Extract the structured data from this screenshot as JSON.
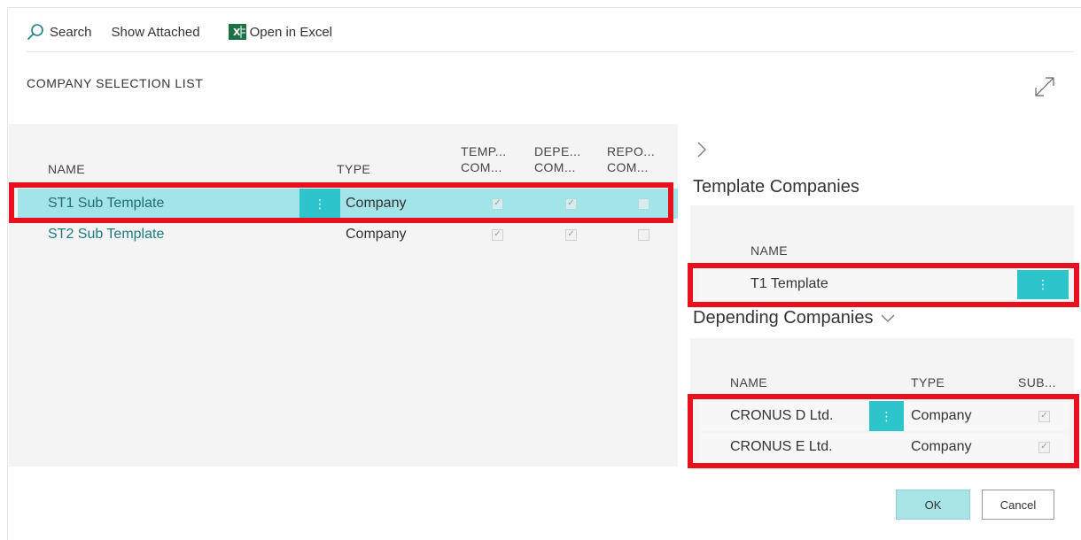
{
  "actionbar": {
    "search_label": "Search",
    "show_attached_label": "Show Attached",
    "open_excel_label": "Open in Excel"
  },
  "page": {
    "title": "COMPANY SELECTION LIST"
  },
  "list": {
    "columns": {
      "name": "NAME",
      "type": "TYPE",
      "template_l1": "TEMP...",
      "template_l2": "COM...",
      "depending_l1": "DEPE...",
      "depending_l2": "COM...",
      "reporting_l1": "REPO...",
      "reporting_l2": "COM..."
    },
    "rows": [
      {
        "name": "ST1 Sub Template",
        "type": "Company",
        "template": true,
        "depending": true,
        "reporting": false,
        "selected": true
      },
      {
        "name": "ST2 Sub Template",
        "type": "Company",
        "template": true,
        "depending": true,
        "reporting": false,
        "selected": false
      }
    ]
  },
  "factbox": {
    "template_companies": {
      "title": "Template Companies",
      "name_header": "NAME",
      "rows": [
        {
          "name": "T1 Template"
        }
      ]
    },
    "depending_companies": {
      "title": "Depending Companies",
      "name_header": "NAME",
      "type_header": "TYPE",
      "sub_header": "SUB...",
      "rows": [
        {
          "name": "CRONUS D Ltd.",
          "type": "Company",
          "sub": true
        },
        {
          "name": "CRONUS E Ltd.",
          "type": "Company",
          "sub": true
        }
      ]
    }
  },
  "buttons": {
    "ok_label": "OK",
    "cancel_label": "Cancel"
  },
  "colors": {
    "accent": "#2ec4cc",
    "selected_row": "#a3e4e8",
    "link": "#1f7b84",
    "highlight_red": "#e8101d",
    "excel_green": "#1e7145"
  },
  "icons": {
    "search": "search-icon",
    "excel": "excel-icon",
    "expand": "expand-icon",
    "chevron_right": "chevron-right-icon",
    "chevron_down": "chevron-down-icon",
    "more": "more-options-icon",
    "check": "checkmark-icon"
  }
}
